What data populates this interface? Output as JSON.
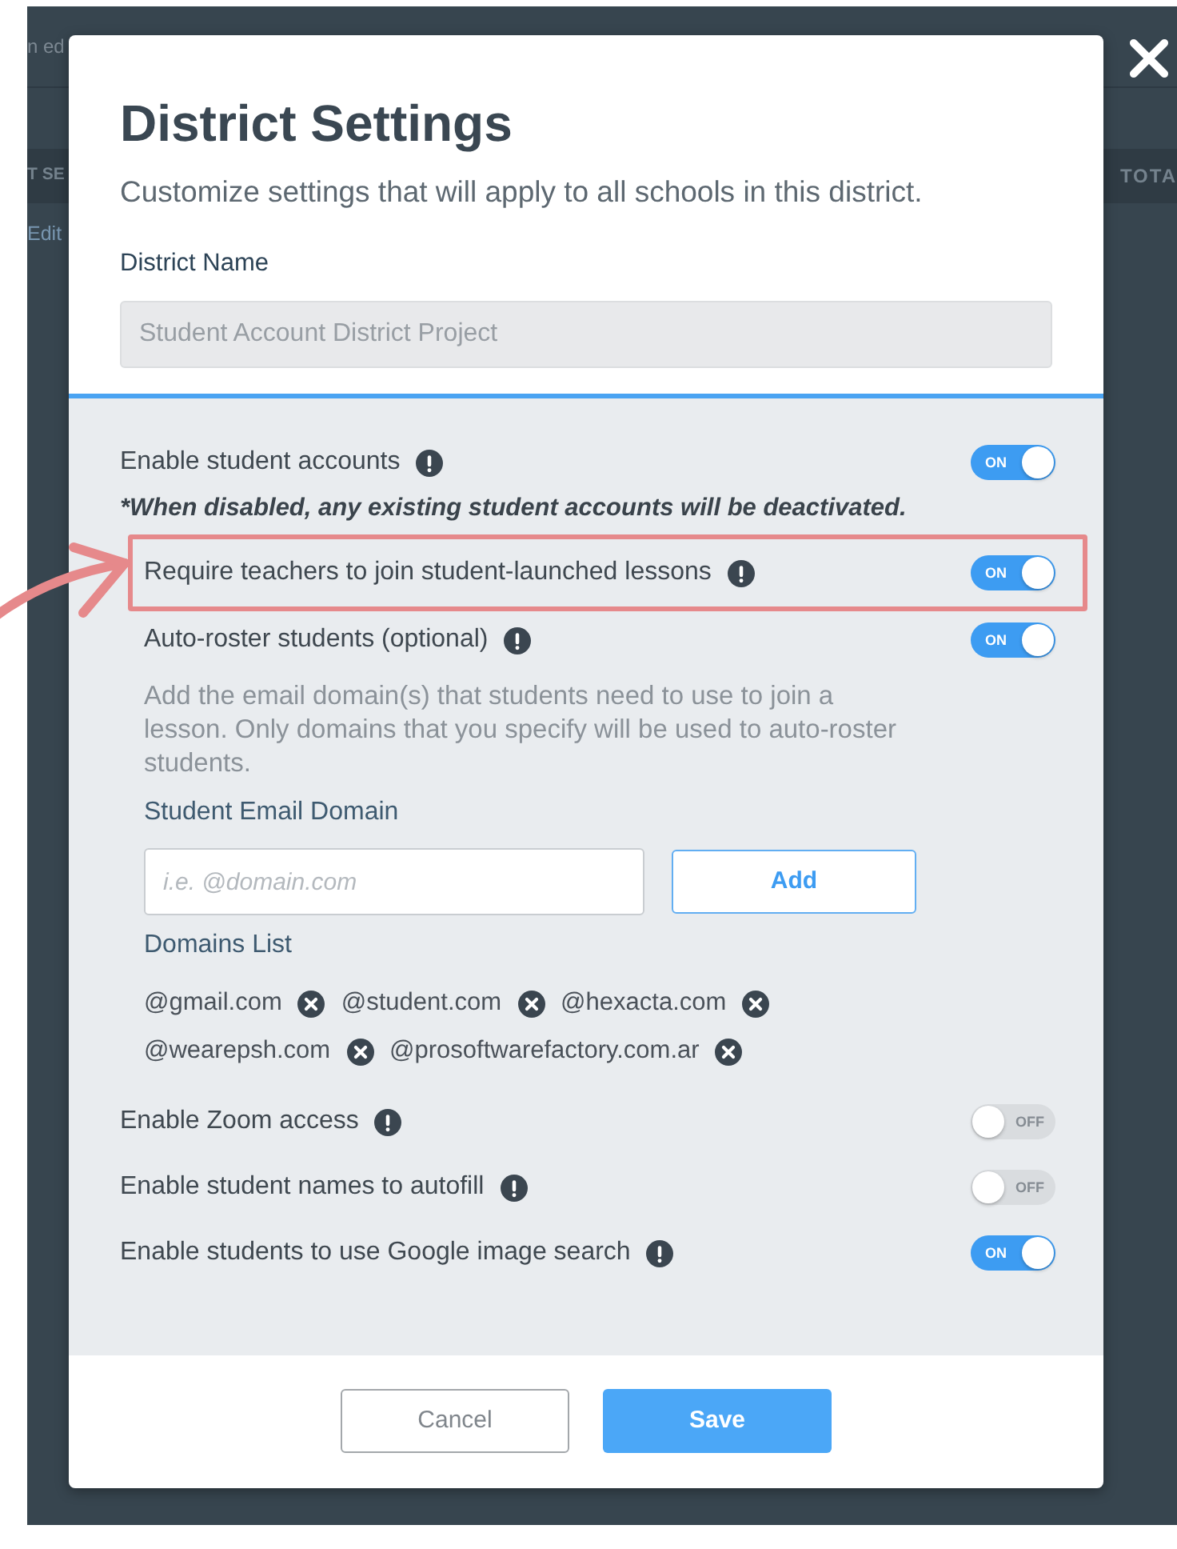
{
  "background_page": {
    "top_text": "n ed",
    "header_cells": [
      "T SE",
      "TOTA"
    ],
    "link": "Edit"
  },
  "modal": {
    "title": "District Settings",
    "subtitle": "Customize settings that will apply to all schools in this district.",
    "district_name": {
      "label": "District Name",
      "value": "Student Account District Project",
      "disabled": true
    }
  },
  "settings": [
    {
      "label": "Enable student accounts",
      "on": true,
      "switch_label": "ON",
      "highlighted": false,
      "note": "*When disabled, any existing student accounts will be deactivated.",
      "children": [
        {
          "label": "Require teachers to join student-launched lessons",
          "on": true,
          "switch_label": "ON",
          "highlighted": true
        },
        {
          "label": "Auto-roster students (optional)",
          "on": true,
          "switch_label": "ON",
          "highlighted": false,
          "description": "Add the email domain(s) that students need to use to join a lesson. Only domains that you specify will be used to auto-roster students.",
          "email_domain": {
            "label": "Student Email Domain",
            "placeholder": "i.e. @domain.com",
            "button": "Add"
          },
          "domains": {
            "label": "Domains List",
            "items": [
              "@gmail.com",
              "@student.com",
              "@hexacta.com",
              "@wearepsh.com",
              "@prosoftwarefactory.com.ar"
            ]
          }
        }
      ]
    },
    {
      "label": "Enable Zoom access",
      "on": false,
      "switch_label": "OFF",
      "highlighted": false
    },
    {
      "label": "Enable student names to autofill",
      "on": false,
      "switch_label": "OFF",
      "highlighted": false
    },
    {
      "label": "Enable students to use Google image search",
      "on": true,
      "switch_label": "ON",
      "highlighted": false
    }
  ],
  "footer": {
    "buttons": [
      {
        "label": "Cancel",
        "kind": "secondary"
      },
      {
        "label": "Save",
        "kind": "primary"
      }
    ]
  }
}
